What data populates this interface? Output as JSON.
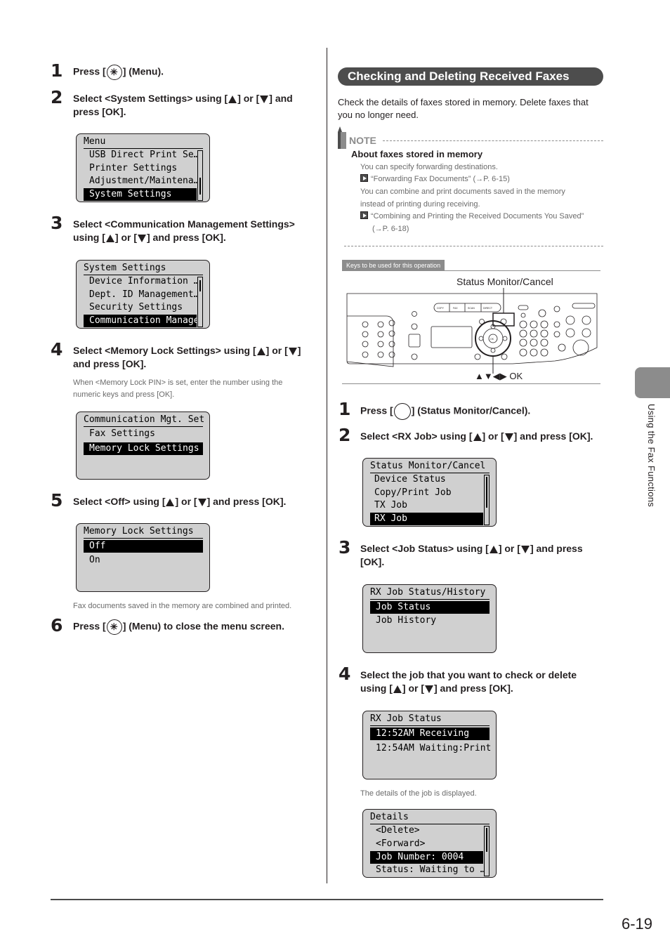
{
  "page": {
    "page_number": "6-19",
    "side_tab_label": "Using the Fax Functions"
  },
  "left_column": {
    "steps": [
      {
        "num": "1",
        "pre": "Press [",
        "post": "] (Menu)."
      },
      {
        "num": "2",
        "line1_pre": "Select <System Settings> using [",
        "line1_mid": "] or [",
        "line1_post": "] and",
        "line2": "press [OK]."
      },
      {
        "num": "3",
        "line1": "Select <Communication Management Settings>",
        "line2_pre": "using [",
        "line2_mid": "] or [",
        "line2_post": "] and press [OK]."
      },
      {
        "num": "4",
        "line1_pre": "Select <Memory Lock Settings> using [",
        "line1_mid": "] or [",
        "line1_post": "]",
        "line2": "and press [OK].",
        "note_line1": "When <Memory Lock PIN> is set, enter the number using the",
        "note_line2": "numeric keys and press [OK]."
      },
      {
        "num": "5",
        "pre": "Select <Off> using [",
        "mid": "] or [",
        "post": "] and press [OK].",
        "note": "Fax documents saved in the memory are combined and printed."
      },
      {
        "num": "6",
        "pre": "Press [",
        "post": "] (Menu) to close the menu screen."
      }
    ],
    "lcd_screens": [
      {
        "title": "Menu",
        "rows": [
          "USB Direct Print Se…",
          "Printer Settings",
          "Adjustment/Maintena…",
          "System Settings"
        ],
        "selected_index": 3,
        "scroll_position": 0.75
      },
      {
        "title": "System Settings",
        "rows": [
          "Device Information …",
          "Dept. ID Management…",
          "Security Settings",
          "Communication Manage"
        ],
        "selected_index": 3,
        "scroll_position": 0.1
      },
      {
        "title": "Communication Mgt. Set",
        "rows": [
          "Fax Settings",
          "Memory Lock Settings"
        ],
        "selected_index": 1
      },
      {
        "title": "Memory Lock Settings",
        "rows": [
          "Off",
          "On"
        ],
        "selected_index": 0
      }
    ]
  },
  "right_column": {
    "section_title": "Checking and Deleting Received Faxes",
    "intro_line1": "Check the details of faxes stored in memory. Delete faxes that",
    "intro_line2": "you no longer need.",
    "note": {
      "label": "NOTE",
      "heading": "About faxes stored in memory",
      "line1": "You can specify forwarding destinations.",
      "xref1": "“Forwarding Fax Documents” (→P. 6-15)",
      "line2": "You can combine and print documents saved in the memory",
      "line3": "instead of printing during receiving.",
      "xref2": "“Combining and Printing the Received Documents You Saved”",
      "xref2_page": "(→P. 6-18)"
    },
    "keys_box": {
      "label": "Keys to be used for this operation",
      "callout_top": "Status Monitor/Cancel",
      "callout_bottom": "▲▼◀▶ OK",
      "panel_buttons": [
        "COPY",
        "FAX",
        "SCAN",
        "DIRECT PRINT",
        "OK"
      ]
    },
    "steps": [
      {
        "num": "1",
        "pre": "Press [",
        "post": "] (Status Monitor/Cancel)."
      },
      {
        "num": "2",
        "pre": "Select <RX Job> using [",
        "mid": "] or [",
        "post": "] and press [OK]."
      },
      {
        "num": "3",
        "line1_pre": "Select <Job Status> using [",
        "line1_mid": "] or [",
        "line1_post": "] and press",
        "line2": "[OK]."
      },
      {
        "num": "4",
        "line1": "Select the job that you want to check or delete",
        "line2_pre": "using [",
        "line2_mid": "] or [",
        "line2_post": "] and press [OK].",
        "note": "The details of the job is displayed."
      }
    ],
    "lcd_screens": [
      {
        "title": "Status Monitor/Cancel",
        "rows": [
          "Device Status",
          "Copy/Print Job",
          "TX Job",
          "RX Job"
        ],
        "selected_index": 3,
        "scroll_position": 0.0
      },
      {
        "title": "RX Job Status/History",
        "rows": [
          "Job Status",
          "Job History"
        ],
        "selected_index": 0
      },
      {
        "title": "RX Job Status",
        "rows": [
          "12:52AM Receiving",
          "12:54AM Waiting:Print"
        ],
        "selected_index": 0
      },
      {
        "title": "Details",
        "rows": [
          "<Delete>",
          "<Forward>",
          "Job Number: 0004",
          "Status: Waiting to …"
        ],
        "selected_index": 2,
        "scroll_position": 0.0
      }
    ]
  }
}
